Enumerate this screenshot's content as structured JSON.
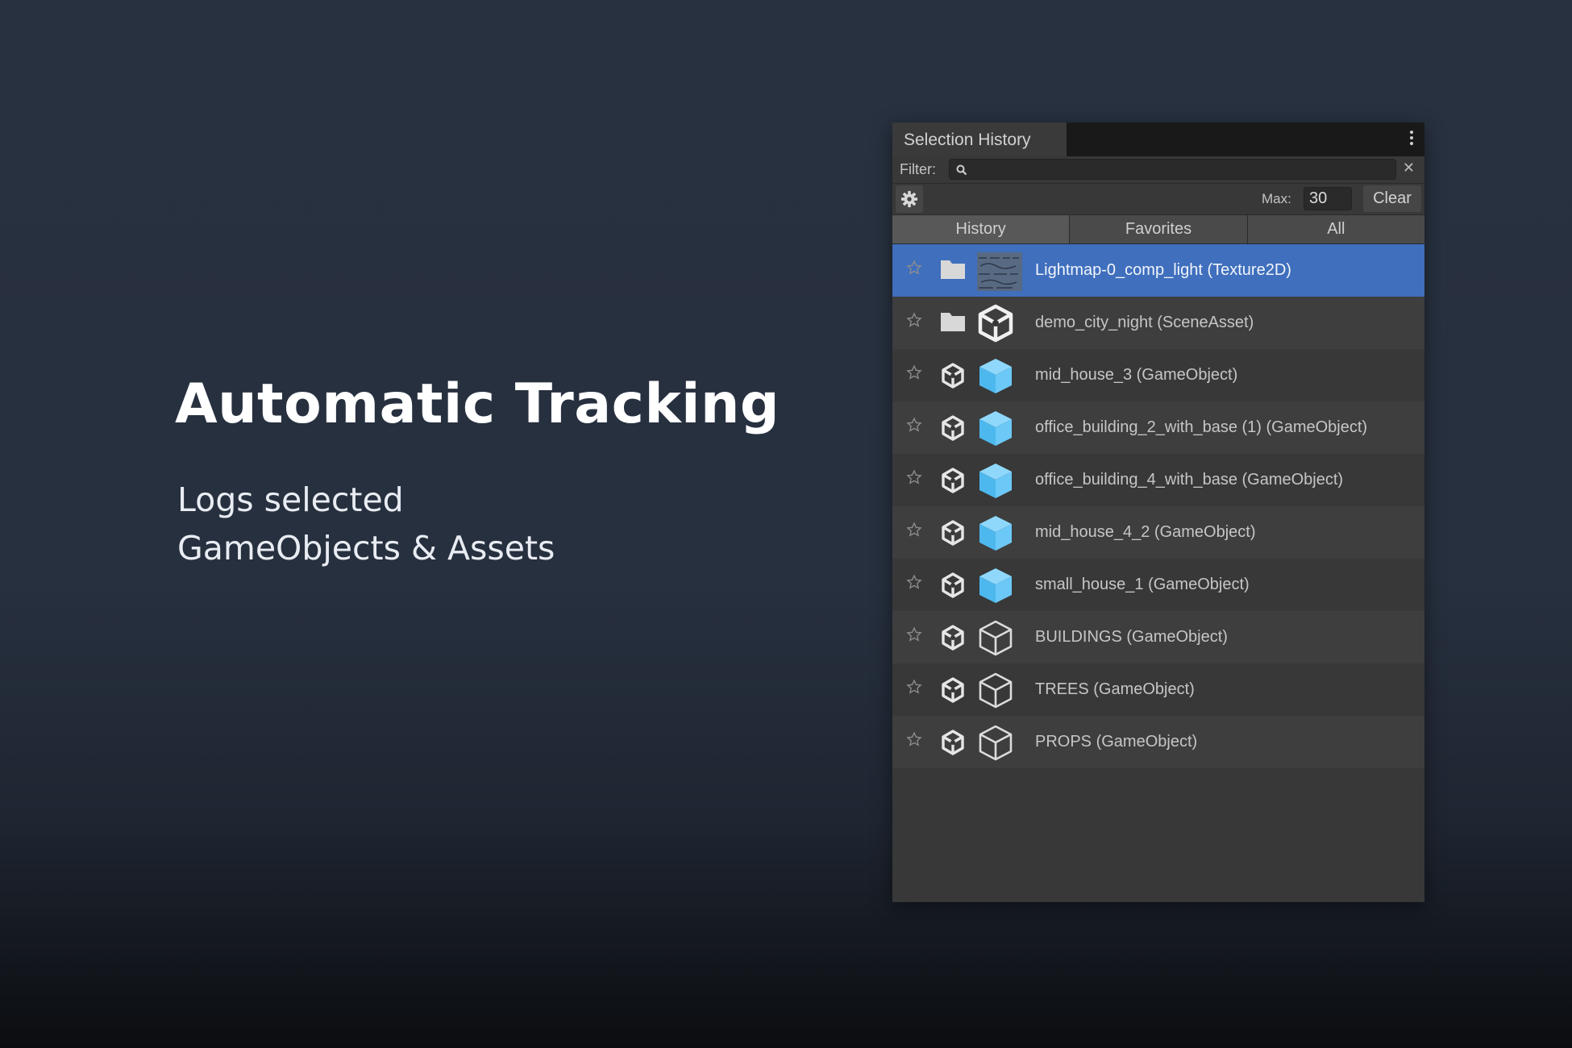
{
  "hero": {
    "title": "Automatic Tracking",
    "subtitle_line1": "Logs selected",
    "subtitle_line2": "GameObjects & Assets"
  },
  "window": {
    "tab_title": "Selection History",
    "menu_icon": "kebab-menu-icon"
  },
  "filter": {
    "label": "Filter:",
    "value": "",
    "search_icon": "search-icon",
    "clear_icon": "close-icon"
  },
  "toolbar": {
    "settings_icon": "gear-icon",
    "max_label": "Max:",
    "max_value": "30",
    "clear_label": "Clear"
  },
  "tabs": [
    {
      "label": "History",
      "active": true
    },
    {
      "label": "Favorites",
      "active": false
    },
    {
      "label": "All",
      "active": false
    }
  ],
  "items": [
    {
      "label": "Lightmap-0_comp_light (Texture2D)",
      "kind_icon": "folder-icon",
      "thumb_icon": "texture-thumbnail-icon",
      "selected": true
    },
    {
      "label": "demo_city_night (SceneAsset)",
      "kind_icon": "folder-icon",
      "thumb_icon": "unity-scene-icon",
      "selected": false
    },
    {
      "label": "mid_house_3 (GameObject)",
      "kind_icon": "unity-logo-icon",
      "thumb_icon": "prefab-cube-icon",
      "selected": false
    },
    {
      "label": "office_building_2_with_base (1) (GameObject)",
      "kind_icon": "unity-logo-icon",
      "thumb_icon": "prefab-cube-icon",
      "selected": false
    },
    {
      "label": "office_building_4_with_base (GameObject)",
      "kind_icon": "unity-logo-icon",
      "thumb_icon": "prefab-cube-icon",
      "selected": false
    },
    {
      "label": "mid_house_4_2 (GameObject)",
      "kind_icon": "unity-logo-icon",
      "thumb_icon": "prefab-cube-icon",
      "selected": false
    },
    {
      "label": "small_house_1 (GameObject)",
      "kind_icon": "unity-logo-icon",
      "thumb_icon": "prefab-cube-icon",
      "selected": false
    },
    {
      "label": "BUILDINGS (GameObject)",
      "kind_icon": "unity-logo-icon",
      "thumb_icon": "gameobject-cube-icon",
      "selected": false
    },
    {
      "label": "TREES (GameObject)",
      "kind_icon": "unity-logo-icon",
      "thumb_icon": "gameobject-cube-icon",
      "selected": false
    },
    {
      "label": "PROPS (GameObject)",
      "kind_icon": "unity-logo-icon",
      "thumb_icon": "gameobject-cube-icon",
      "selected": false
    }
  ],
  "colors": {
    "selection": "#3f6fbd",
    "prefab_blue": "#5cc3f5",
    "panel_bg": "#383838"
  }
}
